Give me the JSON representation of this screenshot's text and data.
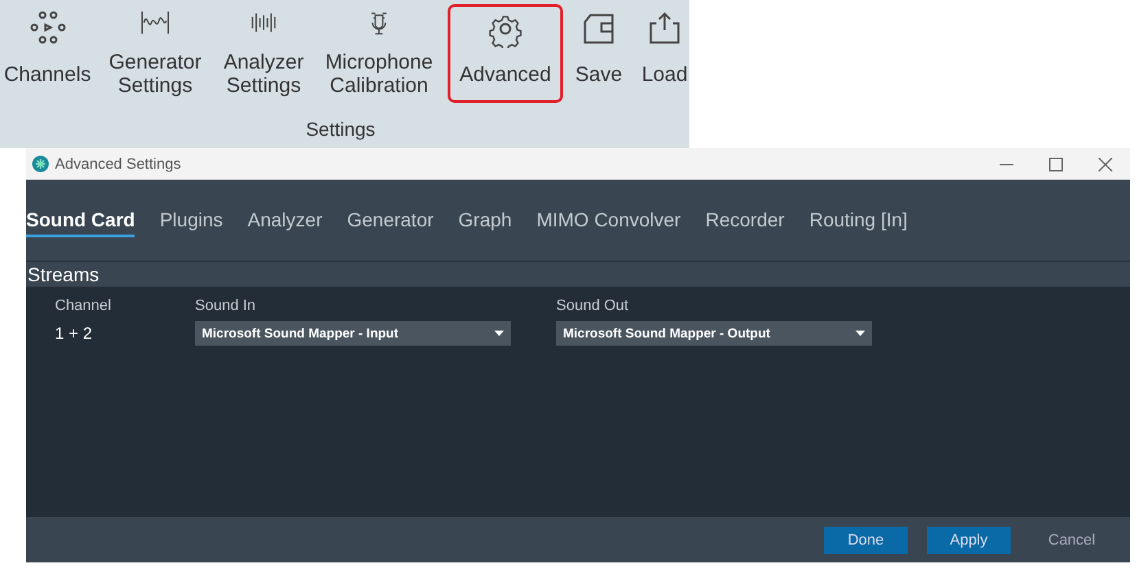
{
  "ribbon": {
    "items": [
      {
        "label": "Channels",
        "selected": false
      },
      {
        "label": "Generator Settings",
        "selected": false
      },
      {
        "label": "Analyzer Settings",
        "selected": false
      },
      {
        "label": "Microphone Calibration",
        "selected": false
      },
      {
        "label": "Advanced",
        "selected": true
      },
      {
        "label": "Save",
        "selected": false
      },
      {
        "label": "Load",
        "selected": false
      }
    ],
    "group_label": "Settings"
  },
  "window": {
    "title": "Advanced Settings",
    "tabs": [
      {
        "label": "Sound Card",
        "selected": true
      },
      {
        "label": "Plugins",
        "selected": false
      },
      {
        "label": "Analyzer",
        "selected": false
      },
      {
        "label": "Generator",
        "selected": false
      },
      {
        "label": "Graph",
        "selected": false
      },
      {
        "label": "MIMO Convolver",
        "selected": false
      },
      {
        "label": "Recorder",
        "selected": false
      },
      {
        "label": "Routing [In]",
        "selected": false
      }
    ],
    "section": "Streams",
    "columns": [
      "Channel",
      "Sound In",
      "Sound Out"
    ],
    "rows": [
      {
        "channel": "1 + 2",
        "sound_in": "Microsoft Sound Mapper - Input",
        "sound_out": "Microsoft Sound Mapper - Output"
      }
    ],
    "buttons": [
      {
        "label": "Done",
        "kind": "primary"
      },
      {
        "label": "Apply",
        "kind": "primary"
      },
      {
        "label": "Cancel",
        "kind": "plain"
      }
    ]
  }
}
